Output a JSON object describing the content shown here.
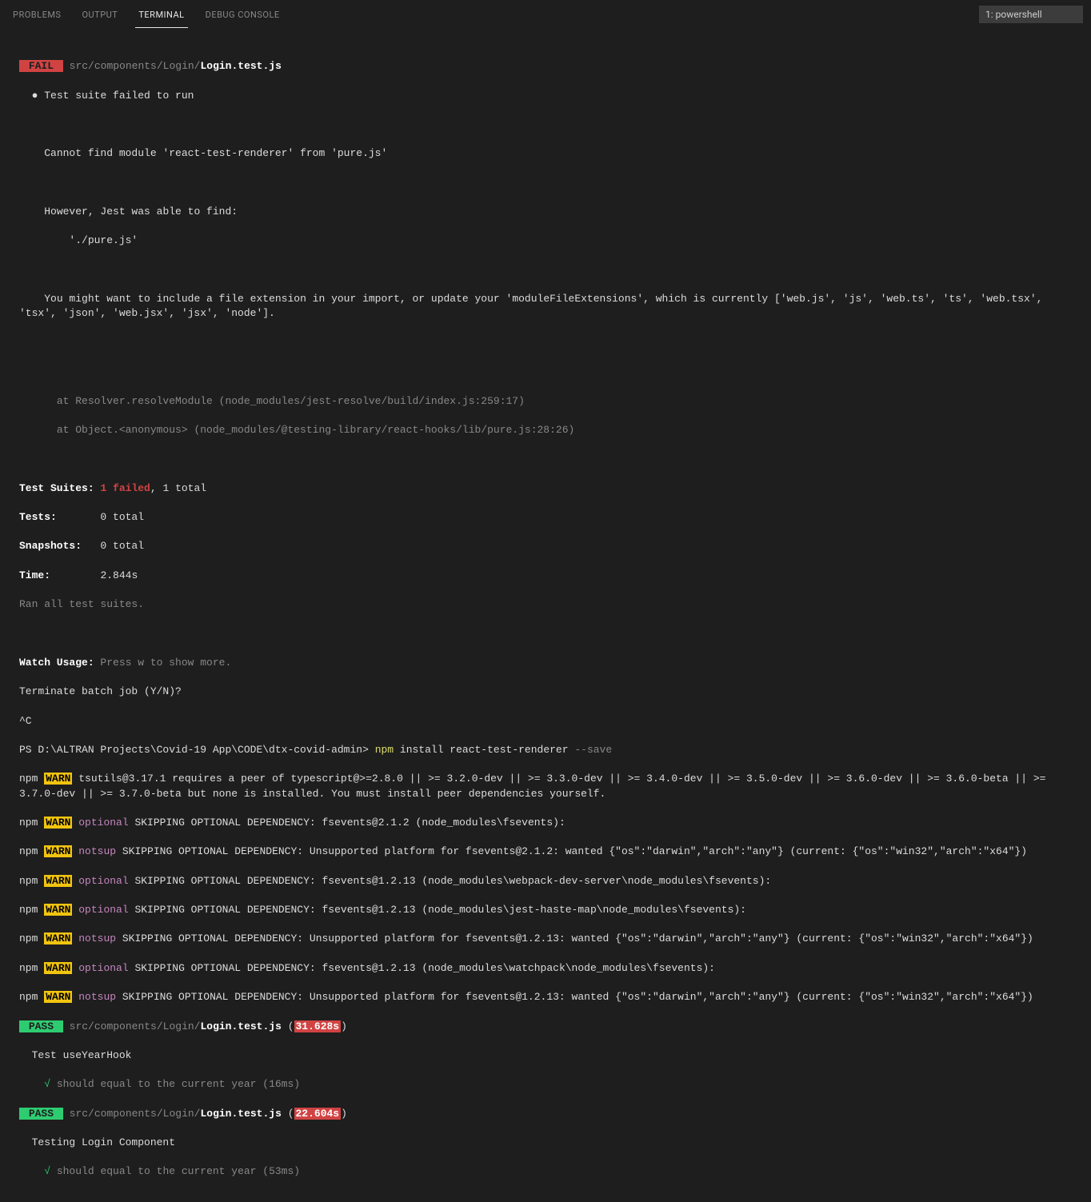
{
  "tabs": {
    "problems": "PROBLEMS",
    "output": "OUTPUT",
    "terminal": "TERMINAL",
    "debug": "DEBUG CONSOLE"
  },
  "shell": {
    "selected": "1: powershell"
  },
  "fail": {
    "badge": " FAIL ",
    "path_dim": "src/components/Login/",
    "path_bold": "Login.test.js",
    "bullet": "●",
    "suite_failed": "Test suite failed to run",
    "err1": "Cannot find module 'react-test-renderer' from 'pure.js'",
    "err2": "However, Jest was able to find:",
    "err3": "'./pure.js'",
    "err4": "You might want to include a file extension in your import, or update your 'moduleFileExtensions', which is currently ['web.js', 'js', 'web.ts', 'ts', 'web.tsx', 'tsx', 'json', 'web.jsx', 'jsx', 'node'].",
    "stack1": "at Resolver.resolveModule (node_modules/jest-resolve/build/index.js:259:17)",
    "stack2": "at Object.<anonymous> (node_modules/@testing-library/react-hooks/lib/pure.js:28:26)"
  },
  "summary": {
    "suites_label": "Test Suites:",
    "suites_fail": "1 failed",
    "suites_rest": ", 1 total",
    "tests_label": "Tests:",
    "tests_val": "0 total",
    "snapshots_label": "Snapshots:",
    "snapshots_val": "0 total",
    "time_label": "Time:",
    "time_val": "2.844s",
    "ran": "Ran all test suites."
  },
  "watch": {
    "label": "Watch Usage:",
    "text": " Press w to show more.",
    "terminate": "Terminate batch job (Y/N)?",
    "ctrlc": "^C"
  },
  "prompt": {
    "ps": "PS D:\\ALTRAN Projects\\Covid-19 App\\CODE\\dtx-covid-admin> ",
    "npm": "npm",
    "cmd": " install react-test-renderer ",
    "flag": "--save"
  },
  "npm": {
    "prefix": "npm ",
    "warn": "WARN",
    "peer": " tsutils@3.17.1 requires a peer of typescript@>=2.8.0 || >= 3.2.0-dev || >= 3.3.0-dev || >= 3.4.0-dev || >= 3.5.0-dev || >= 3.6.0-dev || >= 3.6.0-beta || >= 3.7.0-dev || >= 3.7.0-beta but none is installed. You must install peer dependencies yourself.",
    "optional": " optional",
    "notsup": " notsup",
    "opt1": " SKIPPING OPTIONAL DEPENDENCY: fsevents@2.1.2 (node_modules\\fsevents):",
    "notsup1": " SKIPPING OPTIONAL DEPENDENCY: Unsupported platform for fsevents@2.1.2: wanted {\"os\":\"darwin\",\"arch\":\"any\"} (current: {\"os\":\"win32\",\"arch\":\"x64\"})",
    "opt2": " SKIPPING OPTIONAL DEPENDENCY: fsevents@1.2.13 (node_modules\\webpack-dev-server\\node_modules\\fsevents):",
    "opt3": " SKIPPING OPTIONAL DEPENDENCY: fsevents@1.2.13 (node_modules\\jest-haste-map\\node_modules\\fsevents):",
    "notsup2": " SKIPPING OPTIONAL DEPENDENCY: Unsupported platform for fsevents@1.2.13: wanted {\"os\":\"darwin\",\"arch\":\"any\"} (current: {\"os\":\"win32\",\"arch\":\"x64\"})",
    "opt4": " SKIPPING OPTIONAL DEPENDENCY: fsevents@1.2.13 (node_modules\\watchpack\\node_modules\\fsevents):"
  },
  "pass": {
    "badge": " PASS ",
    "path_dim": "src/components/Login/",
    "path_bold": "Login.test.js",
    "open": " (",
    "close": ")",
    "time1": "31.628s",
    "time2": "22.604s",
    "suite1": "Test useYearHook",
    "check": "√",
    "test1": " should equal to the current year (16ms)",
    "suite2": "Testing Login Component",
    "test2": " should equal to the current year (53ms)"
  }
}
